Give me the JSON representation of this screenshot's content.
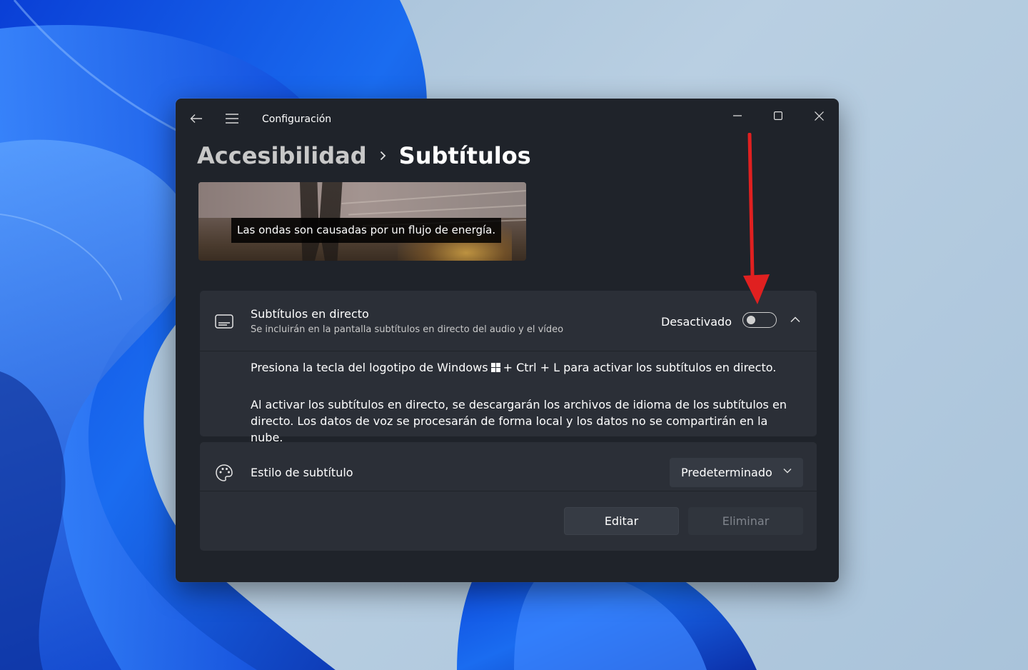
{
  "window": {
    "app_title": "Configuración",
    "controls": {
      "minimize": "minimize-icon",
      "maximize": "maximize-icon",
      "close": "close-icon"
    }
  },
  "breadcrumb": {
    "parent": "Accesibilidad",
    "current": "Subtítulos"
  },
  "preview": {
    "caption": "Las ondas son causadas por un flujo de energía."
  },
  "live_captions": {
    "title": "Subtítulos en directo",
    "subtitle": "Se incluirán en la pantalla subtítulos en directo del audio y el vídeo",
    "state_label": "Desactivado",
    "toggle_on": false,
    "info_line1_before": "Presiona la tecla del logotipo de Windows",
    "info_line1_after": "+ Ctrl + L para activar los subtítulos en directo.",
    "info_paragraph": "Al activar los subtítulos en directo, se descargarán los archivos de idioma de los subtítulos en directo. Los datos de voz se procesarán de forma local y los datos no se compartirán en la nube."
  },
  "caption_style": {
    "title": "Estilo de subtítulo",
    "selected": "Predeterminado",
    "edit_label": "Editar",
    "delete_label": "Eliminar"
  },
  "colors": {
    "window_bg": "#1f232a",
    "card_bg": "#2b2f37",
    "annotation_arrow": "#e02020"
  }
}
